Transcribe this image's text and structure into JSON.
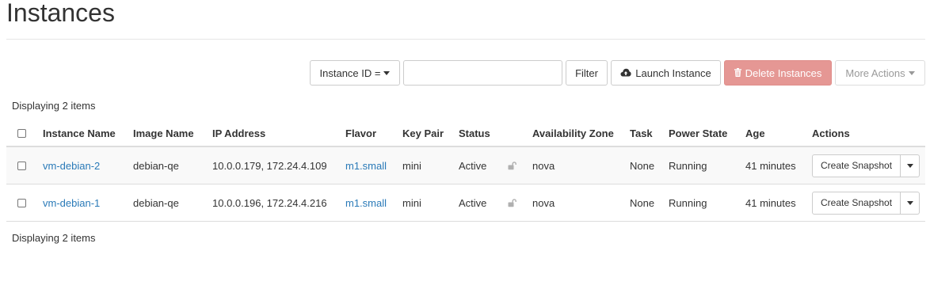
{
  "page": {
    "title": "Instances"
  },
  "toolbar": {
    "filter_field_label": "Instance ID =",
    "filter_input_value": "",
    "filter_button": "Filter",
    "launch_button": "Launch Instance",
    "delete_button": "Delete Instances",
    "more_button": "More Actions",
    "icons": {
      "launch": "cloud-upload-icon",
      "delete": "trash-icon"
    },
    "colors": {
      "delete_bg": "#e59794",
      "link": "#2a7ab8"
    }
  },
  "summary": {
    "top": "Displaying 2 items",
    "bottom": "Displaying 2 items"
  },
  "table": {
    "headers": {
      "name": "Instance Name",
      "image": "Image Name",
      "ip": "IP Address",
      "flavor": "Flavor",
      "keypair": "Key Pair",
      "status": "Status",
      "az": "Availability Zone",
      "task": "Task",
      "power": "Power State",
      "age": "Age",
      "actions": "Actions"
    },
    "rows": [
      {
        "name": "vm-debian-2",
        "image": "debian-qe",
        "ip": "10.0.0.179, 172.24.4.109",
        "flavor": "m1.small",
        "keypair": "mini",
        "status": "Active",
        "lock_icon": "unlock-icon",
        "az": "nova",
        "task": "None",
        "power": "Running",
        "age": "41 minutes",
        "action": "Create Snapshot"
      },
      {
        "name": "vm-debian-1",
        "image": "debian-qe",
        "ip": "10.0.0.196, 172.24.4.216",
        "flavor": "m1.small",
        "keypair": "mini",
        "status": "Active",
        "lock_icon": "unlock-icon",
        "az": "nova",
        "task": "None",
        "power": "Running",
        "age": "41 minutes",
        "action": "Create Snapshot"
      }
    ]
  }
}
